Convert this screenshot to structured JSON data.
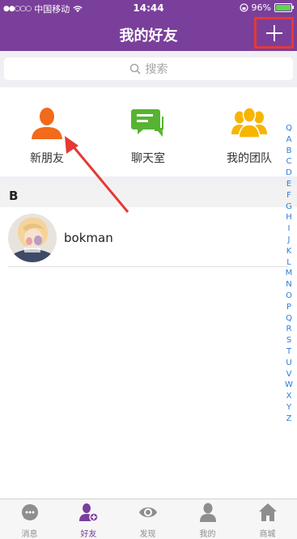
{
  "status": {
    "carrier": "中国移动",
    "time": "14:44",
    "battery": "96%"
  },
  "nav": {
    "title": "我的好友"
  },
  "search": {
    "placeholder": "搜索"
  },
  "shortcuts": [
    {
      "label": "新朋友",
      "icon": "new-friend-icon",
      "color": "#f26a1b"
    },
    {
      "label": "聊天室",
      "icon": "chat-room-icon",
      "color": "#56b431"
    },
    {
      "label": "我的团队",
      "icon": "team-icon",
      "color": "#f7b500"
    }
  ],
  "section": {
    "letter": "B"
  },
  "contacts": [
    {
      "name": "bokman"
    }
  ],
  "index": [
    "Q",
    "A",
    "B",
    "C",
    "D",
    "E",
    "F",
    "G",
    "H",
    "I",
    "J",
    "K",
    "L",
    "M",
    "N",
    "O",
    "P",
    "Q",
    "R",
    "S",
    "T",
    "U",
    "V",
    "W",
    "X",
    "Y",
    "Z"
  ],
  "tabs": [
    {
      "label": "消息",
      "icon": "message-icon"
    },
    {
      "label": "好友",
      "icon": "friends-icon",
      "active": true
    },
    {
      "label": "发现",
      "icon": "discover-icon"
    },
    {
      "label": "我的",
      "icon": "me-icon"
    },
    {
      "label": "商城",
      "icon": "shop-icon"
    }
  ],
  "colors": {
    "primary": "#7a3f9b",
    "highlight": "#e53935",
    "index": "#2f7bd9"
  }
}
